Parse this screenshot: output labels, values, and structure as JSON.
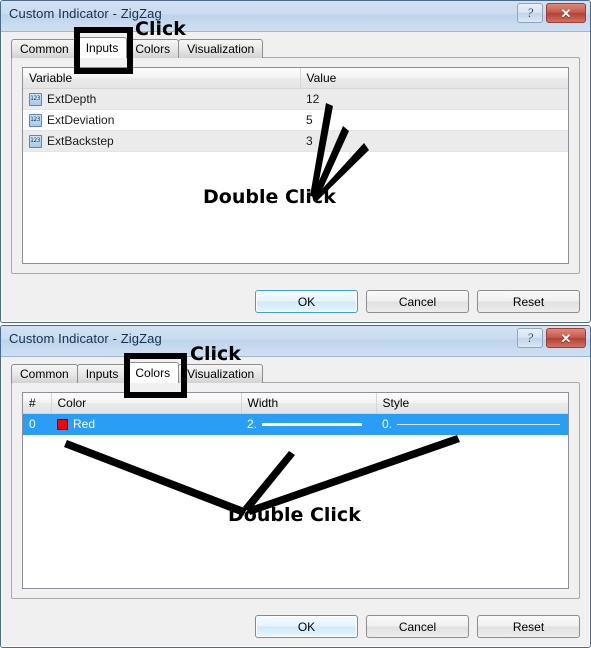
{
  "dialogs": [
    {
      "id": "inputs-dialog",
      "title": "Custom Indicator - ZigZag",
      "help_label": "?",
      "close_label": "✕",
      "tabs": [
        {
          "label": "Common",
          "active": false
        },
        {
          "label": "Inputs",
          "active": true
        },
        {
          "label": "Colors",
          "active": false
        },
        {
          "label": "Visualization",
          "active": false
        }
      ],
      "table": {
        "columns": [
          "Variable",
          "Value"
        ],
        "rows": [
          {
            "icon": "variable-number-icon",
            "variable": "ExtDepth",
            "value": "12"
          },
          {
            "icon": "variable-number-icon",
            "variable": "ExtDeviation",
            "value": "5"
          },
          {
            "icon": "variable-number-icon",
            "variable": "ExtBackstep",
            "value": "3"
          }
        ]
      },
      "buttons": [
        {
          "label": "OK",
          "default": true
        },
        {
          "label": "Cancel",
          "default": false
        },
        {
          "label": "Reset",
          "default": false
        }
      ],
      "annotations": {
        "click": "Click",
        "double_click": "Double Click"
      }
    },
    {
      "id": "colors-dialog",
      "title": "Custom Indicator - ZigZag",
      "help_label": "?",
      "close_label": "✕",
      "tabs": [
        {
          "label": "Common",
          "active": false
        },
        {
          "label": "Inputs",
          "active": false
        },
        {
          "label": "Colors",
          "active": true
        },
        {
          "label": "Visualization",
          "active": false
        }
      ],
      "table": {
        "columns": [
          "#",
          "Color",
          "Width",
          "Style"
        ],
        "rows": [
          {
            "index": "0",
            "color_name": "Red",
            "color_hex": "#ff0000",
            "width": "2.",
            "style": "0.",
            "selected": true
          }
        ]
      },
      "buttons": [
        {
          "label": "OK",
          "default": true
        },
        {
          "label": "Cancel",
          "default": false
        },
        {
          "label": "Reset",
          "default": false
        }
      ],
      "annotations": {
        "click": "Click",
        "double_click": "Double Click"
      }
    }
  ],
  "icons": {
    "variable_number": "123",
    "help": "?",
    "close": "✕"
  },
  "colors": {
    "title_bar_start": "#d3e1f2",
    "title_bar_end": "#cfe0f2",
    "close_button": "#c4584a",
    "selection": "#2a9df4",
    "swatch_red": "#ff0000",
    "annotation": "#000000"
  }
}
